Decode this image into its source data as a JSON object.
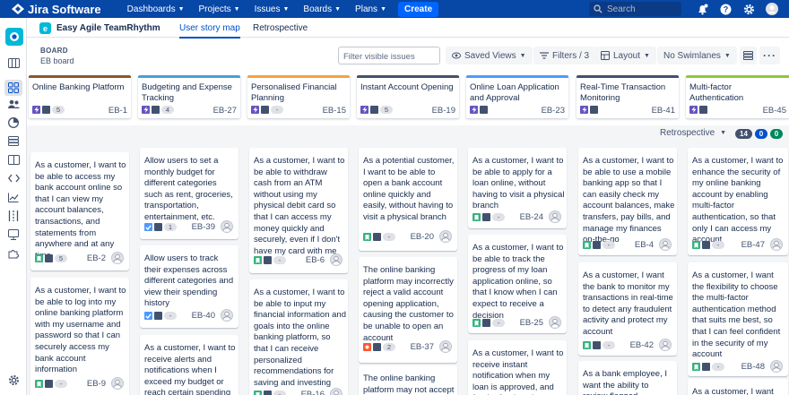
{
  "topnav": {
    "logo": "Jira Software",
    "items": [
      "Dashboards",
      "Projects",
      "Issues",
      "Boards",
      "Plans"
    ],
    "create": "Create",
    "search_placeholder": "Search"
  },
  "header": {
    "app_name": "Easy Agile TeamRhythm",
    "app_badge": "e",
    "tabs": [
      "User story map",
      "Retrospective"
    ]
  },
  "board": {
    "label": "BOARD",
    "name": "EB board"
  },
  "toolbar": {
    "filter_placeholder": "Filter visible issues",
    "saved_views": "Saved Views",
    "filters": "Filters / 3",
    "layout": "Layout",
    "swimlanes": "No Swimlanes"
  },
  "epics": [
    {
      "title": "Online Banking Platform",
      "count": "5",
      "key": "EB-1",
      "color": "#8b572a"
    },
    {
      "title": "Budgeting and Expense Tracking",
      "count": "4",
      "key": "EB-27",
      "color": "#4a9fd8"
    },
    {
      "title": "Personalised Financial Planning",
      "count": "-",
      "key": "EB-15",
      "color": "#f6a23b"
    },
    {
      "title": "Instant Account Opening",
      "count": "5",
      "key": "EB-19",
      "color": "#42526e"
    },
    {
      "title": "Online Loan Application and Approval",
      "count": "",
      "key": "EB-23",
      "color": "#4c9aff"
    },
    {
      "title": "Real-Time Transaction Monitoring",
      "count": "",
      "key": "EB-41",
      "color": "#42526e"
    },
    {
      "title": "Multi-factor Authentication",
      "count": "",
      "key": "EB-45",
      "color": "#8fc93a"
    }
  ],
  "section": {
    "name": "Retrospective",
    "counts": [
      "14",
      "0",
      "0"
    ]
  },
  "cards": [
    {
      "text": "As a customer, I want to be able to access my bank account online so that I can view my account balances, transactions, and statements from anywhere and at any time",
      "count": "5",
      "key": "EB-2",
      "type": "story"
    },
    {
      "text": "As a customer, I want to be able to log into my online banking platform with my username and password so that I can securely access my bank account information",
      "count": "-",
      "key": "EB-9",
      "type": "story"
    },
    {
      "text": "Allow users to set a monthly budget for different categories such as rent, groceries, transportation, entertainment, etc.",
      "count": "1",
      "key": "EB-39",
      "type": "task"
    },
    {
      "text": "Allow users to track their expenses across different categories and view their spending history",
      "count": "-",
      "key": "EB-40",
      "type": "task"
    },
    {
      "text": "As a customer, I want to receive alerts and notifications when I exceed my budget or reach certain spending thresholds, so that I",
      "count": "",
      "key": "",
      "type": "story"
    },
    {
      "text": "As a customer, I want to be able to withdraw cash from an ATM without using my physical debit card so that I can access my money quickly and securely, even if I don't have my card with me",
      "count": "-",
      "key": "EB-6",
      "type": "story"
    },
    {
      "text": "As a customer, I want to be able to input my financial information and goals into the online banking platform, so that I can receive personalized recommendations for saving and investing",
      "count": "-",
      "key": "EB-16",
      "type": "story"
    },
    {
      "text": "As a potential customer, I want to be able to open a bank account online quickly and easily, without having to visit a physical branch",
      "count": "-",
      "key": "EB-20",
      "type": "story"
    },
    {
      "text": "The online banking platform may incorrectly reject a valid account opening application, causing the customer to be unable to open an account",
      "count": "2",
      "key": "EB-37",
      "type": "bug"
    },
    {
      "text": "The online banking platform may not accept valid",
      "count": "",
      "key": "",
      "type": "bug"
    },
    {
      "text": "As a customer, I want to be able to apply for a loan online, without having to visit a physical branch",
      "count": "-",
      "key": "EB-24",
      "type": "story"
    },
    {
      "text": "As a customer, I want to be able to track the progress of my loan application online, so that I know when I can expect to receive a decision",
      "count": "-",
      "key": "EB-25",
      "type": "story"
    },
    {
      "text": "As a customer, I want to receive instant notification when my loan is approved, and for the funds to be",
      "count": "",
      "key": "",
      "type": "story"
    },
    {
      "text": "As a customer, I want to be able to use a mobile banking app so that I can easily check my account balances, make transfers, pay bills, and manage my finances on-the-go",
      "count": "-",
      "key": "EB-4",
      "type": "story"
    },
    {
      "text": "As a customer, I want the bank to monitor my transactions in real-time to detect any fraudulent activity and protect my account",
      "count": "-",
      "key": "EB-42",
      "type": "story"
    },
    {
      "text": "As a bank employee, I want the ability to review flagged",
      "count": "",
      "key": "",
      "type": "story"
    },
    {
      "text": "As a customer, I want to enhance the security of my online banking account by enabling multi-factor authentication, so that only I can access my account",
      "count": "-",
      "key": "EB-47",
      "type": "story"
    },
    {
      "text": "As a customer, I want the flexibility to choose the multi-factor authentication method that suits me best, so that I can feel confident in the security of my account",
      "count": "-",
      "key": "EB-48",
      "type": "story"
    },
    {
      "text": "As a customer, I want",
      "count": "",
      "key": "",
      "type": "story"
    }
  ]
}
